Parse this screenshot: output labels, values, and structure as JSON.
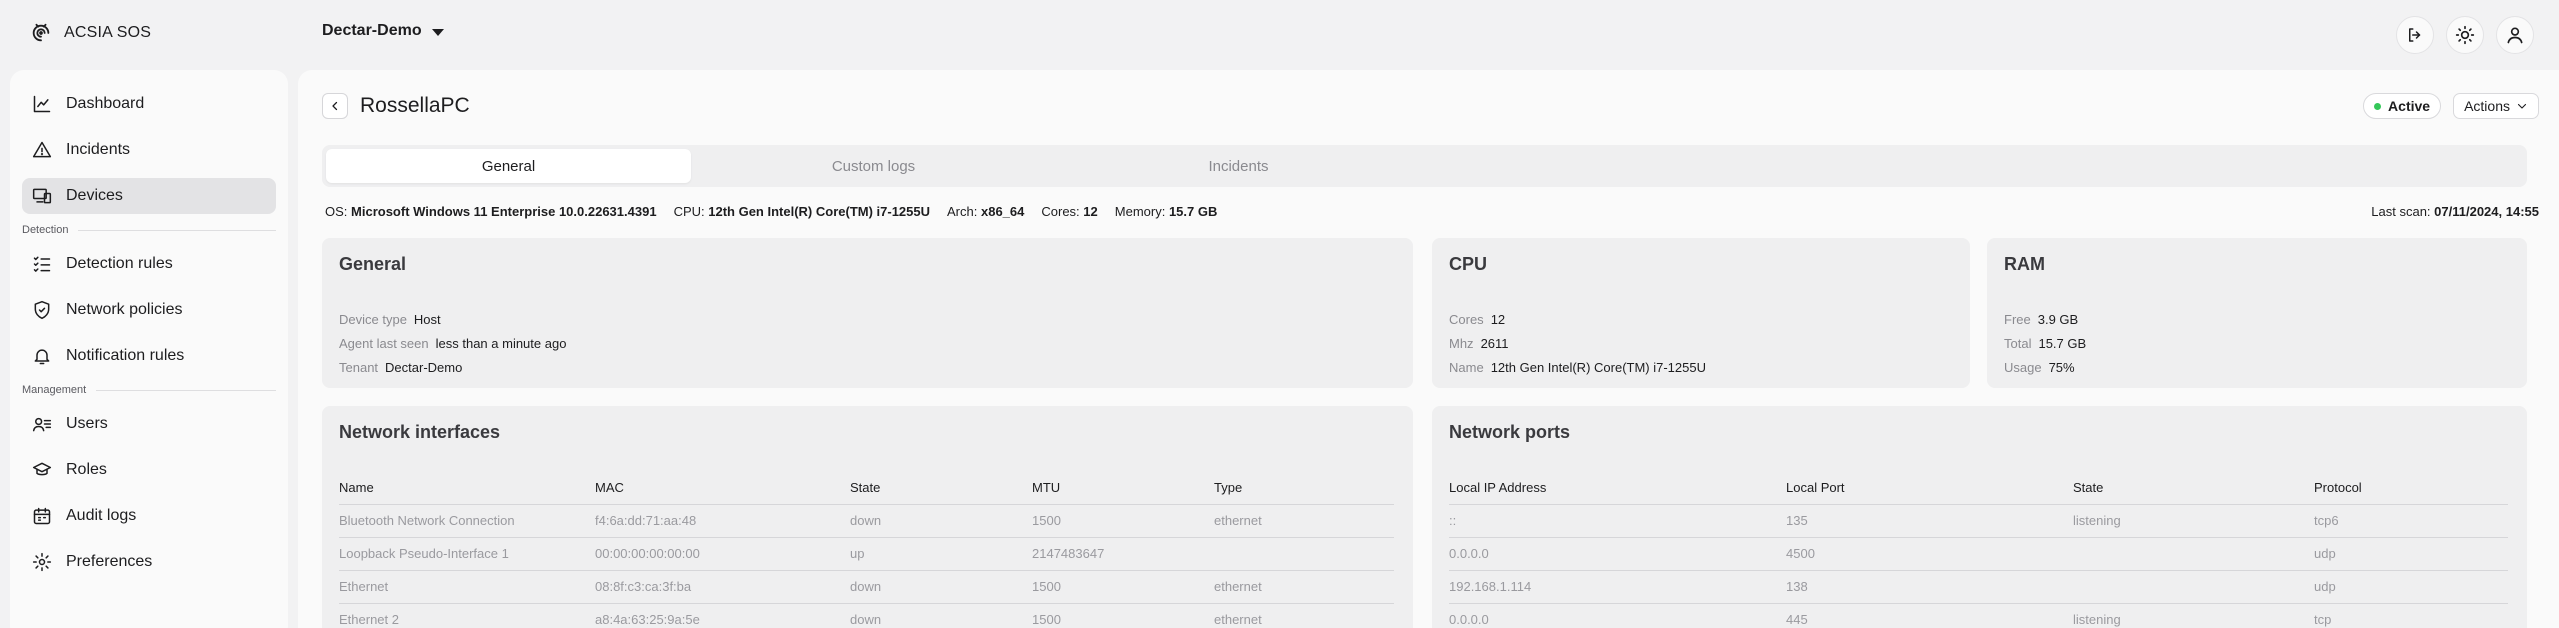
{
  "app": {
    "name": "ACSIA SOS"
  },
  "tenant": {
    "name": "Dectar-Demo"
  },
  "top_actions": [
    {
      "name": "logout-icon"
    },
    {
      "name": "theme-icon"
    },
    {
      "name": "user-icon"
    }
  ],
  "sidebar": {
    "items_main": [
      {
        "label": "Dashboard",
        "icon": "chart-icon"
      },
      {
        "label": "Incidents",
        "icon": "warning-icon"
      },
      {
        "label": "Devices",
        "icon": "devices-icon",
        "active": true
      }
    ],
    "section_detection": "Detection",
    "items_detection": [
      {
        "label": "Detection rules",
        "icon": "list-check-icon"
      },
      {
        "label": "Network policies",
        "icon": "shield-icon"
      },
      {
        "label": "Notification rules",
        "icon": "bell-icon"
      }
    ],
    "section_management": "Management",
    "items_management": [
      {
        "label": "Users",
        "icon": "users-icon"
      },
      {
        "label": "Roles",
        "icon": "graduation-cap-icon"
      },
      {
        "label": "Audit logs",
        "icon": "calendar-icon"
      },
      {
        "label": "Preferences",
        "icon": "gear-icon"
      }
    ]
  },
  "page": {
    "title": "RossellaPC",
    "status": "Active",
    "actions_label": "Actions",
    "status_color": "#34c759"
  },
  "tabs": [
    "General",
    "Custom logs",
    "Incidents"
  ],
  "specs": {
    "os_label": "OS:",
    "os": "Microsoft Windows 11 Enterprise 10.0.22631.4391",
    "cpu_label": "CPU:",
    "cpu": "12th Gen Intel(R) Core(TM) i7-1255U",
    "arch_label": "Arch:",
    "arch": "x86_64",
    "cores_label": "Cores:",
    "cores": "12",
    "memory_label": "Memory:",
    "memory": "15.7 GB",
    "last_scan_label": "Last scan:",
    "last_scan": "07/11/2024, 14:55"
  },
  "general": {
    "title": "General",
    "rows": [
      {
        "k": "Device type",
        "v": "Host"
      },
      {
        "k": "Agent last seen",
        "v": "less than a minute ago"
      },
      {
        "k": "Tenant",
        "v": "Dectar-Demo"
      }
    ]
  },
  "cpu_card": {
    "title": "CPU",
    "rows": [
      {
        "k": "Cores",
        "v": "12"
      },
      {
        "k": "Mhz",
        "v": "2611"
      },
      {
        "k": "Name",
        "v": "12th Gen Intel(R) Core(TM) i7-1255U"
      }
    ]
  },
  "ram_card": {
    "title": "RAM",
    "rows": [
      {
        "k": "Free",
        "v": "3.9 GB"
      },
      {
        "k": "Total",
        "v": "15.7 GB"
      },
      {
        "k": "Usage",
        "v": "75%"
      }
    ]
  },
  "network_interfaces": {
    "title": "Network interfaces",
    "headers": [
      "Name",
      "MAC",
      "State",
      "MTU",
      "Type"
    ],
    "rows": [
      [
        "Bluetooth Network Connection",
        "f4:6a:dd:71:aa:48",
        "down",
        "1500",
        "ethernet"
      ],
      [
        "Loopback Pseudo-Interface 1",
        "00:00:00:00:00:00",
        "up",
        "2147483647",
        ""
      ],
      [
        "Ethernet",
        "08:8f:c3:ca:3f:ba",
        "down",
        "1500",
        "ethernet"
      ],
      [
        "Ethernet 2",
        "a8:4a:63:25:9a:5e",
        "down",
        "1500",
        "ethernet"
      ]
    ]
  },
  "network_ports": {
    "title": "Network ports",
    "headers": [
      "Local IP Address",
      "Local Port",
      "State",
      "Protocol"
    ],
    "rows": [
      [
        "::",
        "135",
        "listening",
        "tcp6"
      ],
      [
        "0.0.0.0",
        "4500",
        "",
        "udp"
      ],
      [
        "192.168.1.114",
        "138",
        "",
        "udp"
      ],
      [
        "0.0.0.0",
        "445",
        "listening",
        "tcp"
      ]
    ]
  }
}
